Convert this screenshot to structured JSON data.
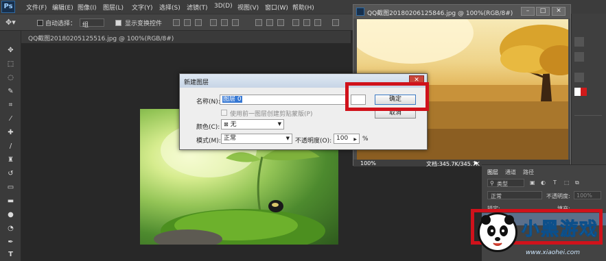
{
  "app": {
    "logo": "Ps"
  },
  "menu": [
    "文件(F)",
    "编辑(E)",
    "图像(I)",
    "图层(L)",
    "文字(Y)",
    "选择(S)",
    "滤镜(T)",
    "3D(D)",
    "视图(V)",
    "窗口(W)",
    "帮助(H)"
  ],
  "options_bar": {
    "auto_select_label": "自动选择：",
    "auto_select_value": "组",
    "show_transform_label": "显示变换控件"
  },
  "document_tab": {
    "title": "QQ截图20180205125516.jpg @ 100%(RGB/8#)"
  },
  "floating_window": {
    "title": "QQ截图20180206125846.jpg @ 100%(RGB/8#)",
    "zoom": "100%",
    "doc_info": "文档:345.7K/345.7K"
  },
  "dialog": {
    "title": "新建图层",
    "name_label": "名称(N):",
    "name_value": "图层 0",
    "clip_label": "使用前一图层创建剪贴蒙版(P)",
    "color_label": "颜色(C):",
    "color_value": "无",
    "mode_label": "模式(M):",
    "mode_value": "正常",
    "opacity_label": "不透明度(O):",
    "opacity_value": "100",
    "opacity_unit": "%",
    "ok_label": "确定",
    "cancel_label": "取消"
  },
  "layers_panel": {
    "tabs": [
      "图层",
      "通道",
      "路径"
    ],
    "filter_label": "类型",
    "blend_mode": "正常",
    "opacity_label": "不透明度:",
    "opacity_value": "100%",
    "lock_label": "锁定:",
    "fill_label": "填充:"
  },
  "watermark": {
    "brand": "小黑游戏",
    "url": "www.xiaohei.com"
  },
  "colors": {
    "highlight": "#d0121b",
    "ps_blue": "#2f6aa3",
    "panel_bg": "#3c3c3c"
  }
}
